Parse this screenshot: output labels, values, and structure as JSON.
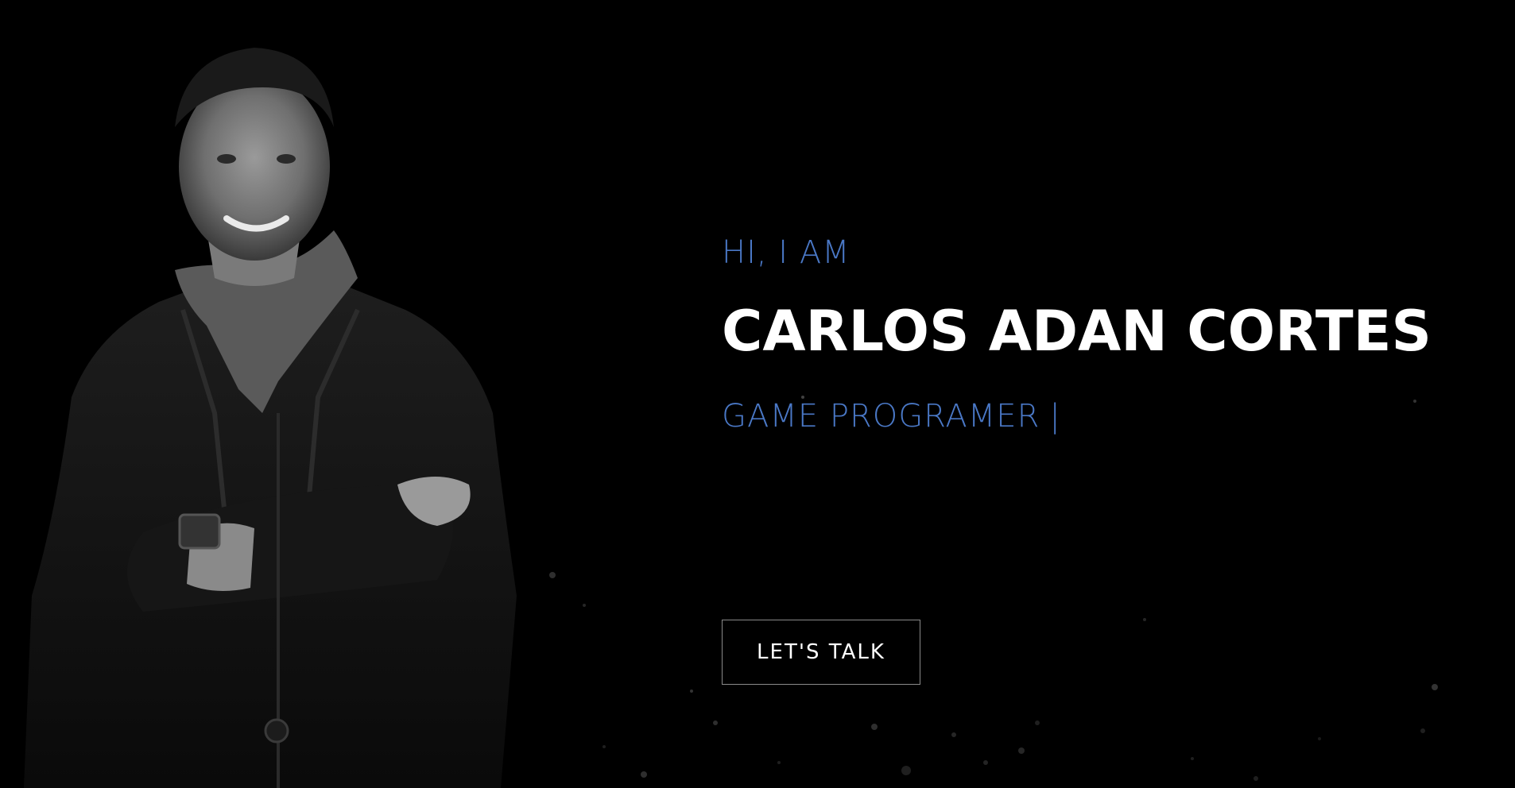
{
  "hero": {
    "greeting": "HI, I AM",
    "name": "CARLOS ADAN CORTES",
    "role": "GAME PROGRAMER",
    "cursor": "|",
    "cta_label": "LET'S TALK"
  },
  "colors": {
    "background": "#000000",
    "accent": "#4a78c6",
    "name": "#ffffff",
    "button_border": "#8a8a8a"
  }
}
